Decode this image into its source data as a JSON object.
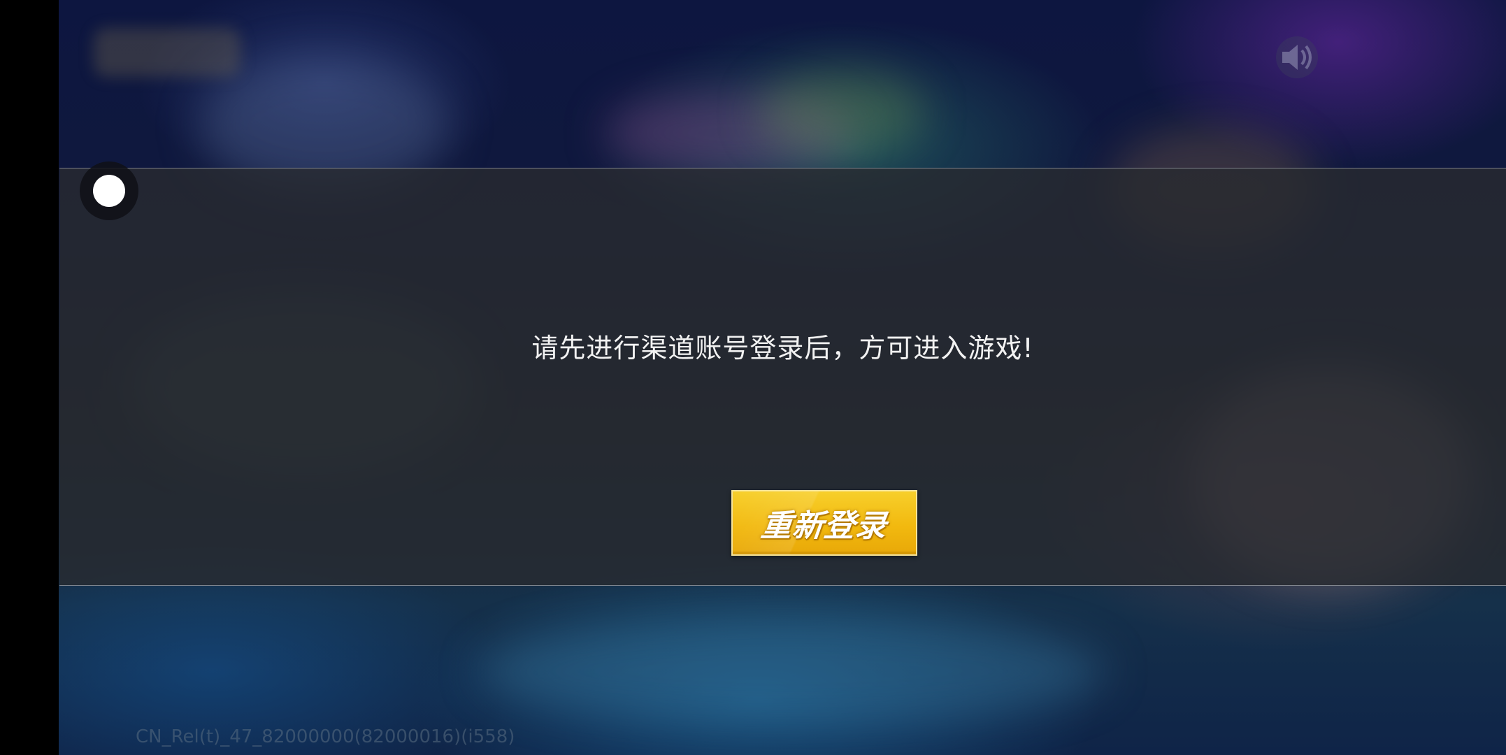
{
  "dialog": {
    "message": "请先进行渠道账号登录后，方可进入游戏!",
    "relogin_button": "重新登录"
  },
  "footer": {
    "version": "CN_Rel(t)_47_82000000(82000016)(i558)"
  },
  "icons": {
    "sound": "speaker-icon",
    "floating": "floating-assistant-icon"
  },
  "colors": {
    "button_yellow": "#f2b90f",
    "dialog_bg": "#282a30",
    "message_text": "#f2f2f2"
  }
}
